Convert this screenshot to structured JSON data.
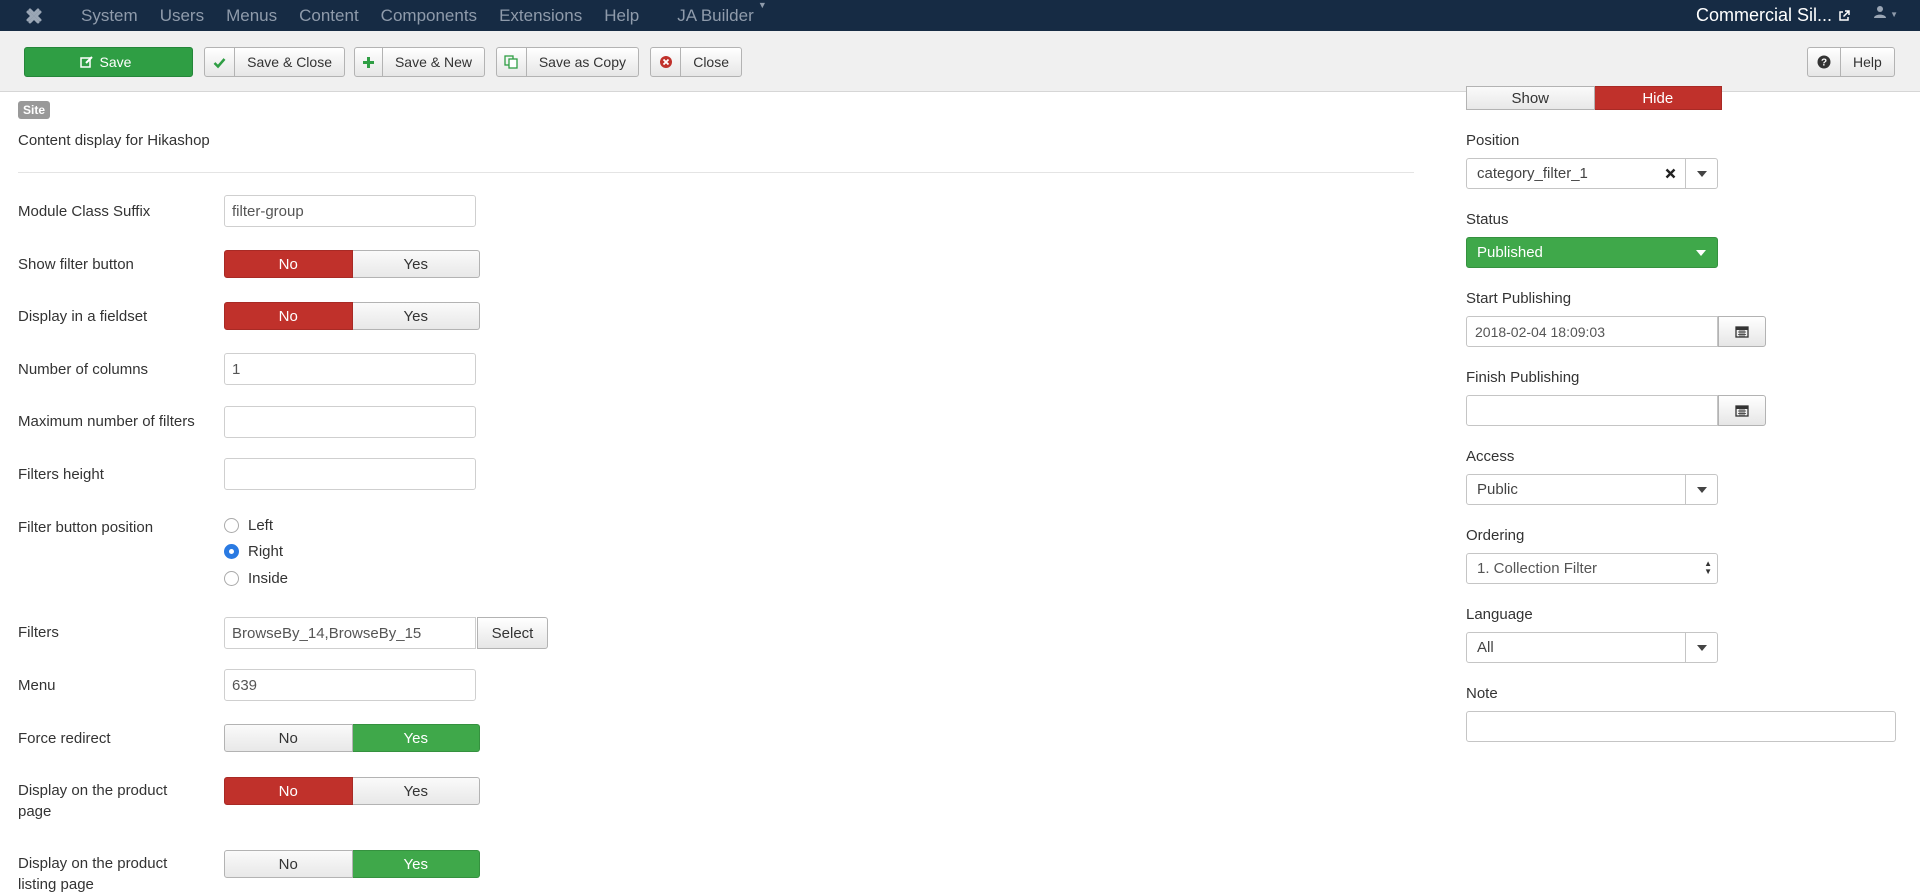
{
  "navbar": {
    "menu": [
      "System",
      "Users",
      "Menus",
      "Content",
      "Components",
      "Extensions",
      "Help"
    ],
    "ja_builder": "JA Builder",
    "site_name": "Commercial Sil..."
  },
  "toolbar": {
    "save": "Save",
    "save_close": "Save & Close",
    "save_new": "Save & New",
    "save_copy": "Save as Copy",
    "close": "Close",
    "help": "Help"
  },
  "module": {
    "badge": "Site",
    "description": "Content display for Hikashop"
  },
  "form": {
    "module_class_suffix": {
      "label": "Module Class Suffix",
      "value": "filter-group"
    },
    "show_filter_button": {
      "label": "Show filter button",
      "no": "No",
      "yes": "Yes",
      "selected": "No"
    },
    "display_fieldset": {
      "label": "Display in a fieldset",
      "no": "No",
      "yes": "Yes",
      "selected": "No"
    },
    "num_columns": {
      "label": "Number of columns",
      "value": "1"
    },
    "max_filters": {
      "label": "Maximum number of filters",
      "value": ""
    },
    "filters_height": {
      "label": "Filters height",
      "value": ""
    },
    "filter_button_position": {
      "label": "Filter button position",
      "options": [
        "Left",
        "Right",
        "Inside"
      ],
      "selected": "Right"
    },
    "filters": {
      "label": "Filters",
      "value": "BrowseBy_14,BrowseBy_15",
      "button": "Select"
    },
    "menu": {
      "label": "Menu",
      "value": "639"
    },
    "force_redirect": {
      "label": "Force redirect",
      "no": "No",
      "yes": "Yes",
      "selected": "Yes"
    },
    "display_product_page": {
      "label_line1": "Display on the product",
      "label_line2": "page",
      "no": "No",
      "yes": "Yes",
      "selected": "No"
    },
    "display_listing_page": {
      "label_line1": "Display on the product",
      "label_line2": "listing page",
      "no": "No",
      "yes": "Yes",
      "selected": "Yes"
    }
  },
  "sidebar": {
    "show_title": {
      "show": "Show",
      "hide": "Hide",
      "selected": "Hide"
    },
    "position": {
      "label": "Position",
      "value": "category_filter_1"
    },
    "status": {
      "label": "Status",
      "value": "Published"
    },
    "start_publishing": {
      "label": "Start Publishing",
      "value": "2018-02-04 18:09:03"
    },
    "finish_publishing": {
      "label": "Finish Publishing",
      "value": ""
    },
    "access": {
      "label": "Access",
      "value": "Public"
    },
    "ordering": {
      "label": "Ordering",
      "value": "1. Collection Filter"
    },
    "language": {
      "label": "Language",
      "value": "All"
    },
    "note": {
      "label": "Note",
      "value": ""
    }
  },
  "colors": {
    "navbar": "#162b44",
    "save_green": "#2f9e44",
    "toggle_red": "#c0312b",
    "toggle_green": "#3fa84a"
  }
}
